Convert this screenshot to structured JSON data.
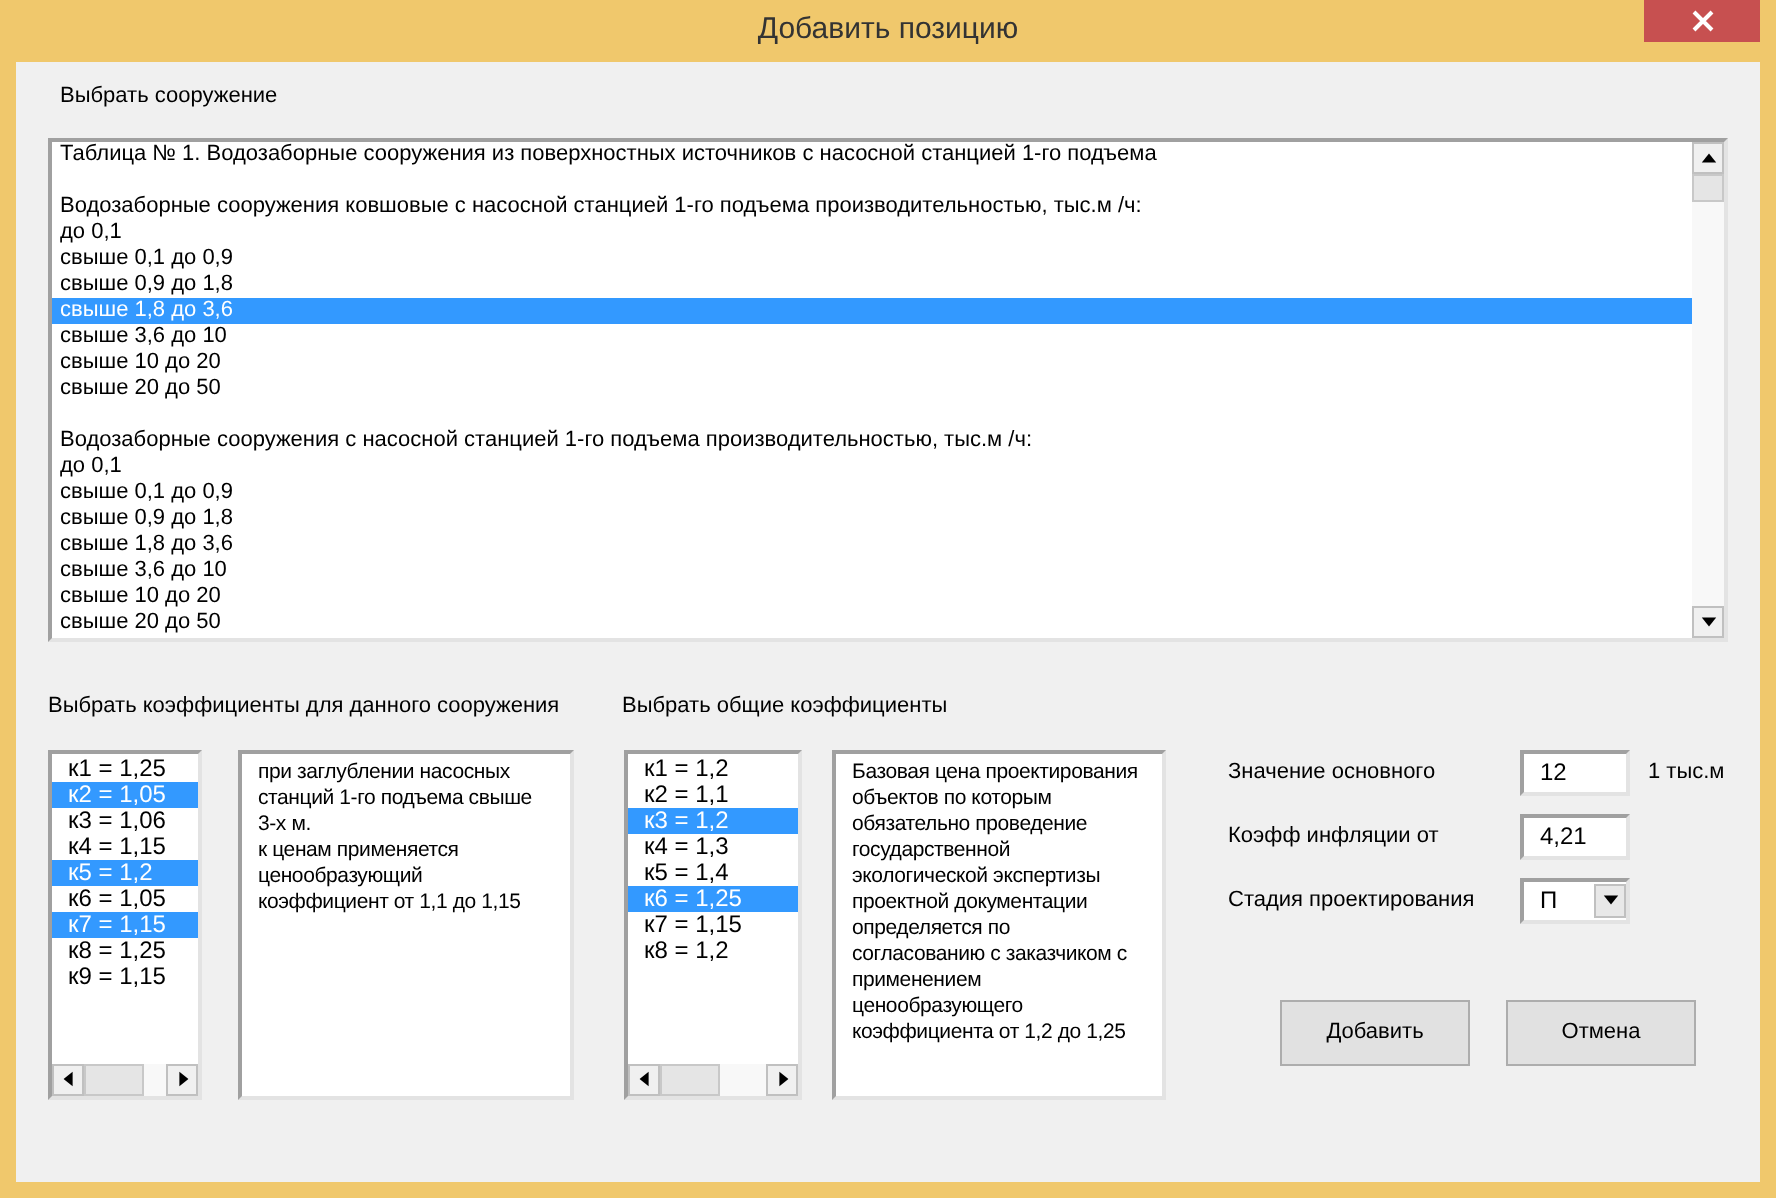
{
  "window": {
    "title": "Добавить позицию"
  },
  "structure_label": "Выбрать сооружение",
  "structure_list": {
    "title": "Таблица № 1. Водозаборные сооружения из поверхностных источников с насосной станцией 1-го подъема",
    "groups": [
      {
        "heading": "Водозаборные сооружения ковшовые с насосной станцией 1-го подъема производительностью, тыс.м /ч:",
        "options": [
          {
            "text": "до 0,1",
            "selected": false
          },
          {
            "text": "свыше 0,1 до 0,9",
            "selected": false
          },
          {
            "text": "свыше 0,9 до 1,8",
            "selected": false
          },
          {
            "text": "свыше 1,8 до 3,6",
            "selected": true
          },
          {
            "text": "свыше 3,6 до 10",
            "selected": false
          },
          {
            "text": "свыше 10 до 20",
            "selected": false
          },
          {
            "text": "свыше 20 до 50",
            "selected": false
          }
        ]
      },
      {
        "heading": "Водозаборные сооружения с насосной станцией 1-го подъема производительностью, тыс.м /ч:",
        "options": [
          {
            "text": "до 0,1",
            "selected": false
          },
          {
            "text": "свыше 0,1 до 0,9",
            "selected": false
          },
          {
            "text": "свыше 0,9 до 1,8",
            "selected": false
          },
          {
            "text": "свыше 1,8 до 3,6",
            "selected": false
          },
          {
            "text": "свыше 3,6 до 10",
            "selected": false
          },
          {
            "text": "свыше 10 до 20",
            "selected": false
          },
          {
            "text": "свыше 20 до 50",
            "selected": false
          }
        ]
      }
    ]
  },
  "specific_coefficients": {
    "label": "Выбрать коэффициенты для данного сооружения",
    "items": [
      {
        "text": "к1 = 1,25",
        "selected": false
      },
      {
        "text": "к2 = 1,05",
        "selected": true
      },
      {
        "text": "к3 = 1,06",
        "selected": false
      },
      {
        "text": "к4 = 1,15",
        "selected": false
      },
      {
        "text": "к5 = 1,2",
        "selected": true
      },
      {
        "text": "к6 = 1,05",
        "selected": false
      },
      {
        "text": "к7 = 1,15",
        "selected": true
      },
      {
        "text": "к8 = 1,25",
        "selected": false
      },
      {
        "text": "к9 = 1,15",
        "selected": false
      }
    ],
    "description": [
      "при заглублении насосных станций 1-го подъема свыше 3-х м.",
      "к ценам применяется ценообразующий коэффициент от 1,1 до 1,15"
    ]
  },
  "general_coefficients": {
    "label": "Выбрать общие коэффициенты",
    "items": [
      {
        "text": "к1 = 1,2",
        "selected": false
      },
      {
        "text": "к2 = 1,1",
        "selected": false
      },
      {
        "text": "к3 = 1,2",
        "selected": true
      },
      {
        "text": "к4 = 1,3",
        "selected": false
      },
      {
        "text": "к5 = 1,4",
        "selected": false
      },
      {
        "text": "к6 = 1,25",
        "selected": true
      },
      {
        "text": "к7 = 1,15",
        "selected": false
      },
      {
        "text": "к8 = 1,2",
        "selected": false
      }
    ],
    "description": [
      "Базовая цена проектирования объектов по которым обязательно проведение государственной экологической экспертизы проектной документации определяется по согласованию с заказчиком с применением ценообразующего коэффициента от 1,2 до 1,25"
    ]
  },
  "form": [
    {
      "kind": "text",
      "label": "Значение основного",
      "value": "12",
      "unit": "1 тыс.м"
    },
    {
      "kind": "text",
      "label": "Коэфф инфляции от",
      "value": "4,21"
    },
    {
      "kind": "select",
      "label": "Стадия проектирования",
      "value": "П"
    }
  ],
  "buttons": [
    "Добавить",
    "Отмена"
  ]
}
